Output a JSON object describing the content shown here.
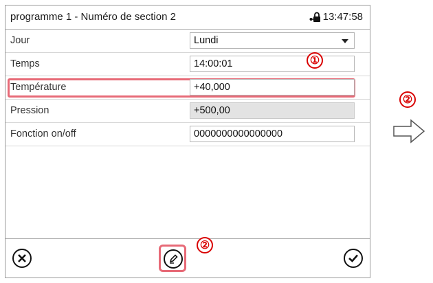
{
  "header": {
    "title": "programme 1 - Numéro de section 2",
    "time": "13:47:58",
    "icon": "lock-icon"
  },
  "rows": [
    {
      "label": "Jour",
      "value": "Lundi",
      "kind": "dropdown"
    },
    {
      "label": "Temps",
      "value": "14:00:01",
      "kind": "text"
    },
    {
      "label": "Température",
      "value": "+40,000",
      "kind": "text"
    },
    {
      "label": "Pression",
      "value": "+500,00",
      "kind": "readonly"
    },
    {
      "label": "Fonction on/off",
      "value": "0000000000000000",
      "kind": "text"
    }
  ],
  "footer": {
    "cancel_icon": "cancel-icon",
    "edit_icon": "edit-pencil-icon",
    "confirm_icon": "checkmark-icon"
  },
  "callouts": {
    "one": "①",
    "two_edit": "②",
    "two_side": "②"
  },
  "colors": {
    "highlight": "#e76a77",
    "callout": "#d90000"
  }
}
